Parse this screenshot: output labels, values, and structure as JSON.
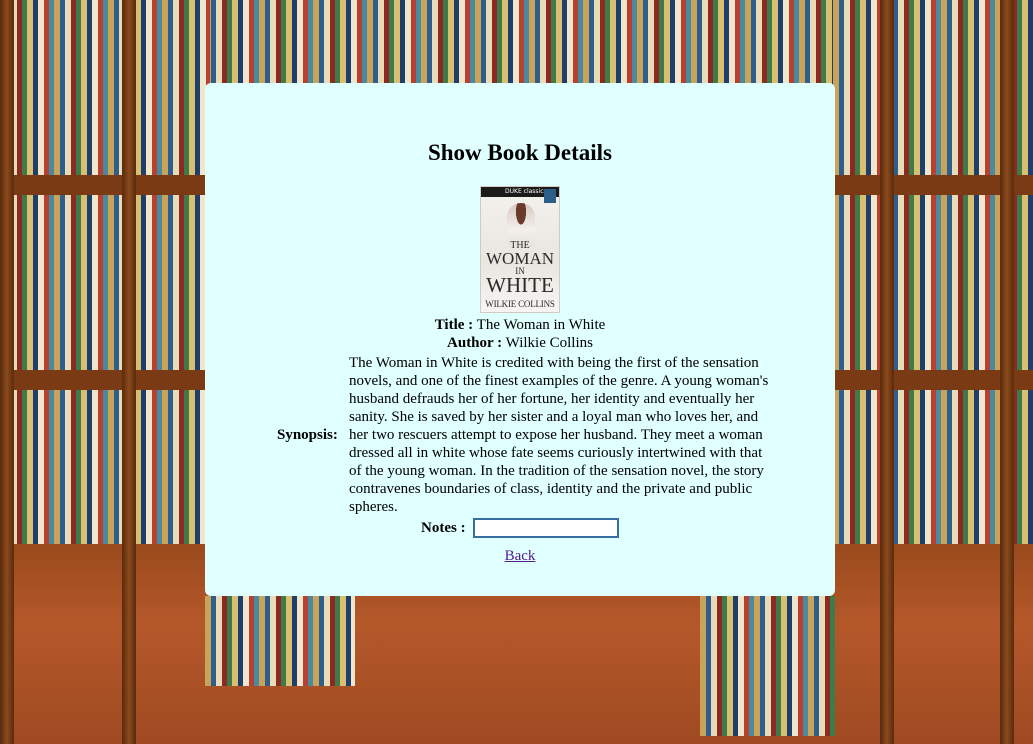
{
  "page": {
    "title": "Show Book Details"
  },
  "book": {
    "cover": {
      "publisher_tag": "DUKE classics",
      "title_line_1": "THE",
      "title_line_2": "WOMAN",
      "title_line_3": "IN",
      "title_line_4": "WHITE",
      "author_line": "WILKIE COLLINS"
    },
    "title_label": "Title :",
    "title_value": "The Woman in White",
    "author_label": "Author :",
    "author_value": "Wilkie Collins",
    "synopsis_label": "Synopsis:",
    "synopsis_text": "The Woman in White is credited with being the first of the sensation novels, and one of the finest examples of the genre. A young woman's husband defrauds her of her fortune, her identity and eventually her sanity. She is saved by her sister and a loyal man who loves her, and her two rescuers attempt to expose her husband. They meet a woman dressed all in white whose fate seems curiously intertwined with that of the young woman. In the tradition of the sensation novel, the story contravenes boundaries of class, identity and the private and public spheres.",
    "notes_label": "Notes :",
    "notes_value": ""
  },
  "nav": {
    "back_label": "Back"
  },
  "colors": {
    "panel_background": "#e0ffff",
    "link": "#551a8b",
    "input_border": "#3b6ea0"
  }
}
